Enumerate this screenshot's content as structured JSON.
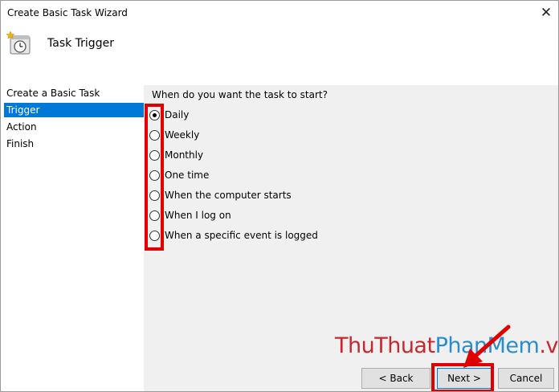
{
  "window": {
    "title": "Create Basic Task Wizard",
    "close_glyph": "✕"
  },
  "header": {
    "heading": "Task Trigger",
    "icon": "task-scheduler-clock-icon"
  },
  "sidebar": {
    "items": [
      {
        "label": "Create a Basic Task",
        "active": false
      },
      {
        "label": "Trigger",
        "active": true
      },
      {
        "label": "Action",
        "active": false
      },
      {
        "label": "Finish",
        "active": false
      }
    ]
  },
  "main": {
    "question": "When do you want the task to start?",
    "options": [
      {
        "label": "Daily",
        "checked": true
      },
      {
        "label": "Weekly",
        "checked": false
      },
      {
        "label": "Monthly",
        "checked": false
      },
      {
        "label": "One time",
        "checked": false
      },
      {
        "label": "When the computer starts",
        "checked": false
      },
      {
        "label": "When I log on",
        "checked": false
      },
      {
        "label": "When a specific event is logged",
        "checked": false
      }
    ]
  },
  "buttons": {
    "back": "< Back",
    "next": "Next >",
    "cancel": "Cancel"
  },
  "watermark": {
    "part1": "ThuThuat",
    "part2": "PhanMem",
    "part3": ".vn"
  },
  "colors": {
    "accent": "#0078d7",
    "highlight": "#e00000",
    "watermark_red": "#c8282d",
    "watermark_blue": "#2c8ccb"
  }
}
